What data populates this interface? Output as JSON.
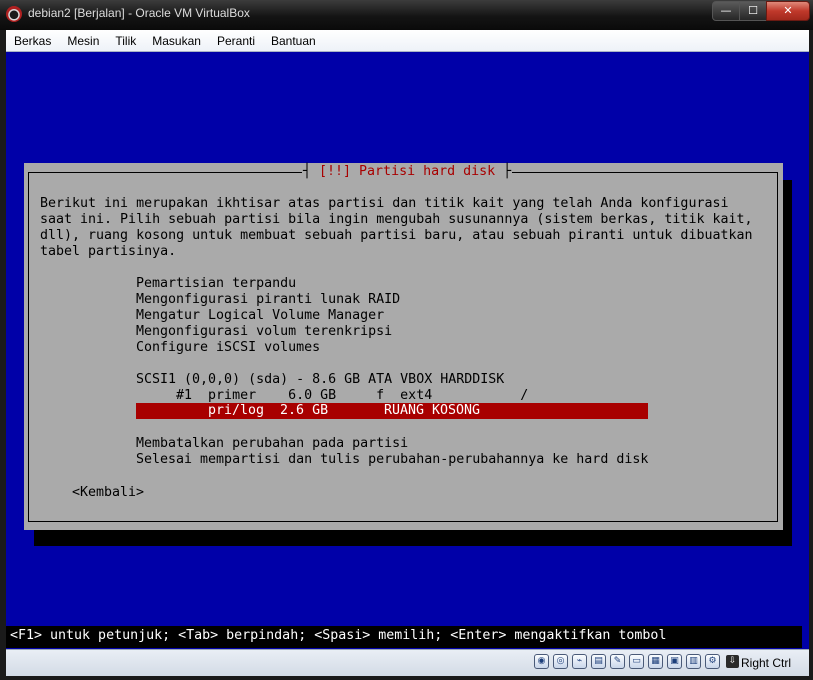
{
  "window": {
    "title": "debian2 [Berjalan] - Oracle VM VirtualBox",
    "minimize_label": "—",
    "maximize_label": "☐",
    "close_label": "✕"
  },
  "menu": [
    "Berkas",
    "Mesin",
    "Tilik",
    "Masukan",
    "Peranti",
    "Bantuan"
  ],
  "installer": {
    "dialog_title": "[!!] Partisi hard disk",
    "intro": [
      "Berikut ini merupakan ikhtisar atas partisi dan titik kait yang telah Anda konfigurasi",
      "saat ini. Pilih sebuah partisi bila ingin mengubah susunannya (sistem berkas, titik kait,",
      "dll), ruang kosong untuk membuat sebuah partisi baru, atau sebuah piranti untuk dibuatkan",
      "tabel partisinya."
    ],
    "options": [
      "Pemartisian terpandu",
      "Mengonfigurasi piranti lunak RAID",
      "Mengatur Logical Volume Manager",
      "Mengonfigurasi volum terenkripsi",
      "Configure iSCSI volumes"
    ],
    "disk": "SCSI1 (0,0,0) (sda) - 8.6 GB ATA VBOX HARDDISK",
    "partition_1": "     #1  primer    6.0 GB     f  ext4           /",
    "free_space_left": "pri/log  2.6 GB",
    "free_space_right": "RUANG KOSONG",
    "undo": "Membatalkan perubahan pada partisi",
    "finish": "Selesai mempartisi dan tulis perubahan-perubahannya ke hard disk",
    "back": "<Kembali>",
    "help": "<F1> untuk petunjuk; <Tab> berpindah; <Spasi> memilih; <Enter> mengaktifkan tombol"
  },
  "statusbar": {
    "host_key": "Right Ctrl",
    "icons": [
      "hard-disk-icon",
      "optical-disk-icon",
      "usb-icon",
      "shared-folders-icon",
      "video-capture-icon",
      "display-icon",
      "network-icon",
      "mouse-integration-icon",
      "virtualization-icon",
      "host-key-icon"
    ]
  },
  "colors": {
    "screen": "#0000a8",
    "dialog": "#aaaaaa",
    "highlight": "#a80000",
    "title_text": "#a80000"
  }
}
